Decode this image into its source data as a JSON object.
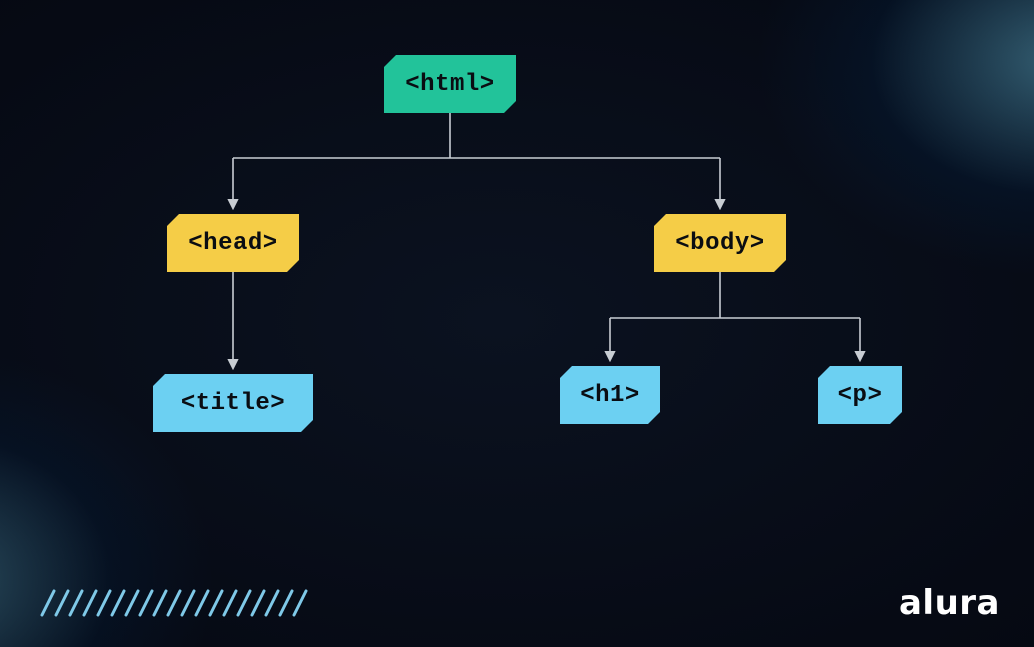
{
  "tree": {
    "root": {
      "label": "<html>",
      "color": "green"
    },
    "children": [
      {
        "label": "<head>",
        "color": "yellow",
        "children": [
          {
            "label": "<title>",
            "color": "blue"
          }
        ]
      },
      {
        "label": "<body>",
        "color": "yellow",
        "children": [
          {
            "label": "<h1>",
            "color": "blue"
          },
          {
            "label": "<p>",
            "color": "blue"
          }
        ]
      }
    ]
  },
  "colors": {
    "green": "#22c39a",
    "yellow": "#f5cd47",
    "blue": "#6cd0f2",
    "background": "#05080e",
    "line": "#c8cdd3"
  },
  "brand": {
    "name": "alura"
  }
}
